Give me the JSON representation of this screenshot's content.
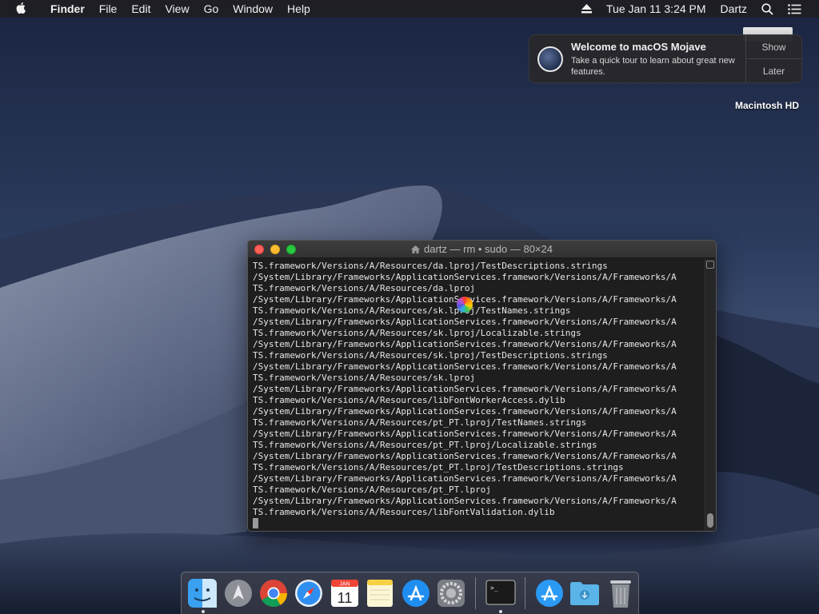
{
  "menubar": {
    "app_name": "Finder",
    "menus": [
      "File",
      "Edit",
      "View",
      "Go",
      "Window",
      "Help"
    ],
    "clock": "Tue Jan 11  3:24 PM",
    "user": "Dartz"
  },
  "notification": {
    "title": "Welcome to macOS Mojave",
    "text": "Take a quick tour to learn about great new features.",
    "show_label": "Show",
    "later_label": "Later"
  },
  "desktop": {
    "hd_label": "Macintosh HD"
  },
  "terminal": {
    "title": "dartz — rm • sudo — 80×24",
    "lines": [
      "TS.framework/Versions/A/Resources/da.lproj/TestDescriptions.strings",
      "/System/Library/Frameworks/ApplicationServices.framework/Versions/A/Frameworks/A",
      "TS.framework/Versions/A/Resources/da.lproj",
      "/System/Library/Frameworks/ApplicationServices.framework/Versions/A/Frameworks/A",
      "TS.framework/Versions/A/Resources/sk.lproj/TestNames.strings",
      "/System/Library/Frameworks/ApplicationServices.framework/Versions/A/Frameworks/A",
      "TS.framework/Versions/A/Resources/sk.lproj/Localizable.strings",
      "/System/Library/Frameworks/ApplicationServices.framework/Versions/A/Frameworks/A",
      "TS.framework/Versions/A/Resources/sk.lproj/TestDescriptions.strings",
      "/System/Library/Frameworks/ApplicationServices.framework/Versions/A/Frameworks/A",
      "TS.framework/Versions/A/Resources/sk.lproj",
      "/System/Library/Frameworks/ApplicationServices.framework/Versions/A/Frameworks/A",
      "TS.framework/Versions/A/Resources/libFontWorkerAccess.dylib",
      "/System/Library/Frameworks/ApplicationServices.framework/Versions/A/Frameworks/A",
      "TS.framework/Versions/A/Resources/pt_PT.lproj/TestNames.strings",
      "/System/Library/Frameworks/ApplicationServices.framework/Versions/A/Frameworks/A",
      "TS.framework/Versions/A/Resources/pt_PT.lproj/Localizable.strings",
      "/System/Library/Frameworks/ApplicationServices.framework/Versions/A/Frameworks/A",
      "TS.framework/Versions/A/Resources/pt_PT.lproj/TestDescriptions.strings",
      "/System/Library/Frameworks/ApplicationServices.framework/Versions/A/Frameworks/A",
      "TS.framework/Versions/A/Resources/pt_PT.lproj",
      "/System/Library/Frameworks/ApplicationServices.framework/Versions/A/Frameworks/A",
      "TS.framework/Versions/A/Resources/libFontValidation.dylib"
    ]
  },
  "dock": {
    "calendar_month": "JAN",
    "calendar_day": "11",
    "terminal_prompt": ">_",
    "apps": [
      "finder-icon",
      "launchpad-icon",
      "chrome-icon",
      "safari-icon",
      "calendar-icon",
      "notes-icon",
      "app-store-icon",
      "system-preferences-icon",
      "terminal-icon",
      "app-store-icon",
      "downloads-folder-icon",
      "trash-icon"
    ]
  },
  "colors": {
    "close": "#fe5f57",
    "minimize": "#febc2e",
    "maximize": "#28c840",
    "terminal_bg": "#1e1e1e"
  }
}
